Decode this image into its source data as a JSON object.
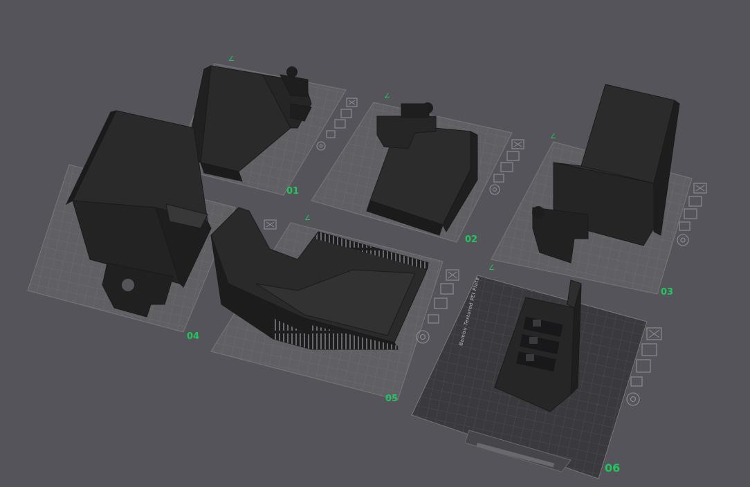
{
  "colors": {
    "background": "#55545a",
    "plate_grid": "#6e6e73",
    "plate_fill": "#5f5f64",
    "textured_plate": "#3a3a3e",
    "model_top": "#2e2e2f",
    "model_side": "#222223",
    "model_dark": "#18181a",
    "label": "#22c55e"
  },
  "plates": [
    {
      "number": "01",
      "icons": [
        "close-icon",
        "arrange-icon",
        "layers-icon",
        "lock-icon",
        "settings-icon"
      ]
    },
    {
      "number": "02",
      "icons": [
        "close-icon",
        "arrange-icon",
        "layers-icon",
        "lock-icon",
        "settings-icon"
      ]
    },
    {
      "number": "03",
      "icons": [
        "close-icon",
        "arrange-icon",
        "layers-icon",
        "lock-icon",
        "settings-icon"
      ]
    },
    {
      "number": "04",
      "icons": [
        "close-icon",
        "arrange-icon",
        "layers-icon",
        "lock-icon",
        "settings-icon"
      ]
    },
    {
      "number": "05",
      "icons": [
        "close-icon",
        "arrange-icon",
        "layers-icon",
        "lock-icon",
        "settings-icon"
      ]
    },
    {
      "number": "06",
      "icons": [
        "close-icon",
        "arrange-icon",
        "layers-icon",
        "lock-icon",
        "settings-icon"
      ]
    }
  ],
  "plate_markers": [
    "∠",
    "∠",
    "∠",
    "∠",
    "∠",
    "∠"
  ],
  "textured_plate_text": "Bambu Textured PEI Plate"
}
